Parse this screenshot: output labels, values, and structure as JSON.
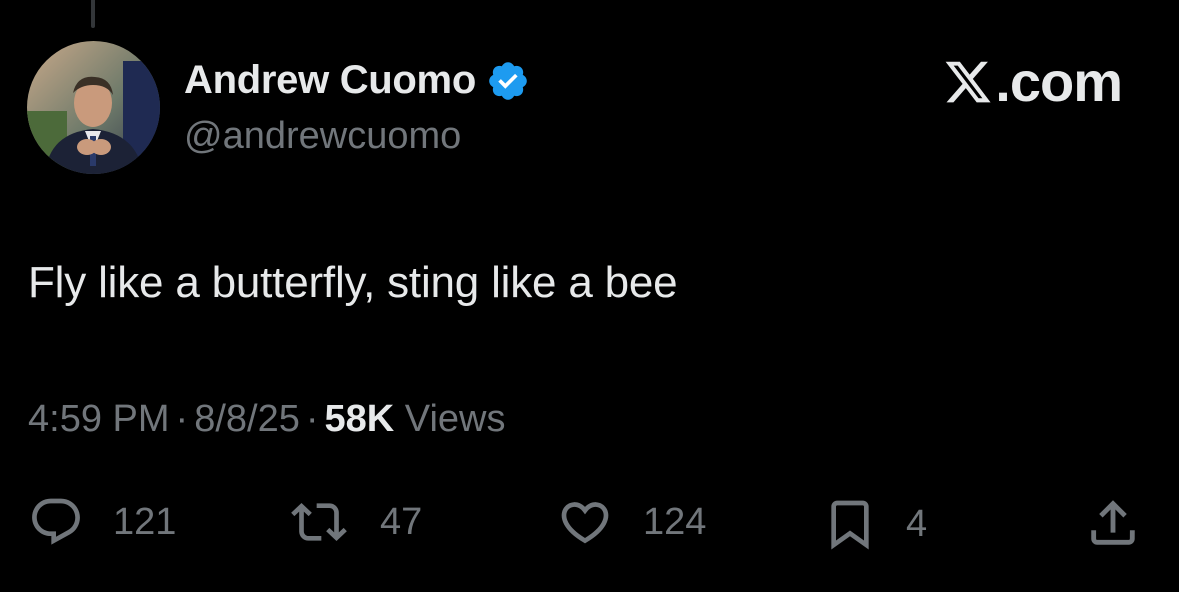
{
  "author": {
    "display_name": "Andrew Cuomo",
    "handle": "@andrewcuomo",
    "verified": true,
    "verified_color": "#1d9bf0"
  },
  "brand": {
    "suffix": ".com",
    "icon": "x-logo-icon"
  },
  "tweet": {
    "text": "Fly like a butterfly, sting like a bee"
  },
  "meta": {
    "time": "4:59 PM",
    "date": "8/8/25",
    "separator": "·",
    "views_count": "58K",
    "views_label": "Views"
  },
  "actions": {
    "replies": "121",
    "reposts": "47",
    "likes": "124",
    "bookmarks": "4"
  },
  "colors": {
    "background": "#000000",
    "primary_text": "#e7e9ea",
    "secondary_text": "#71767b"
  }
}
